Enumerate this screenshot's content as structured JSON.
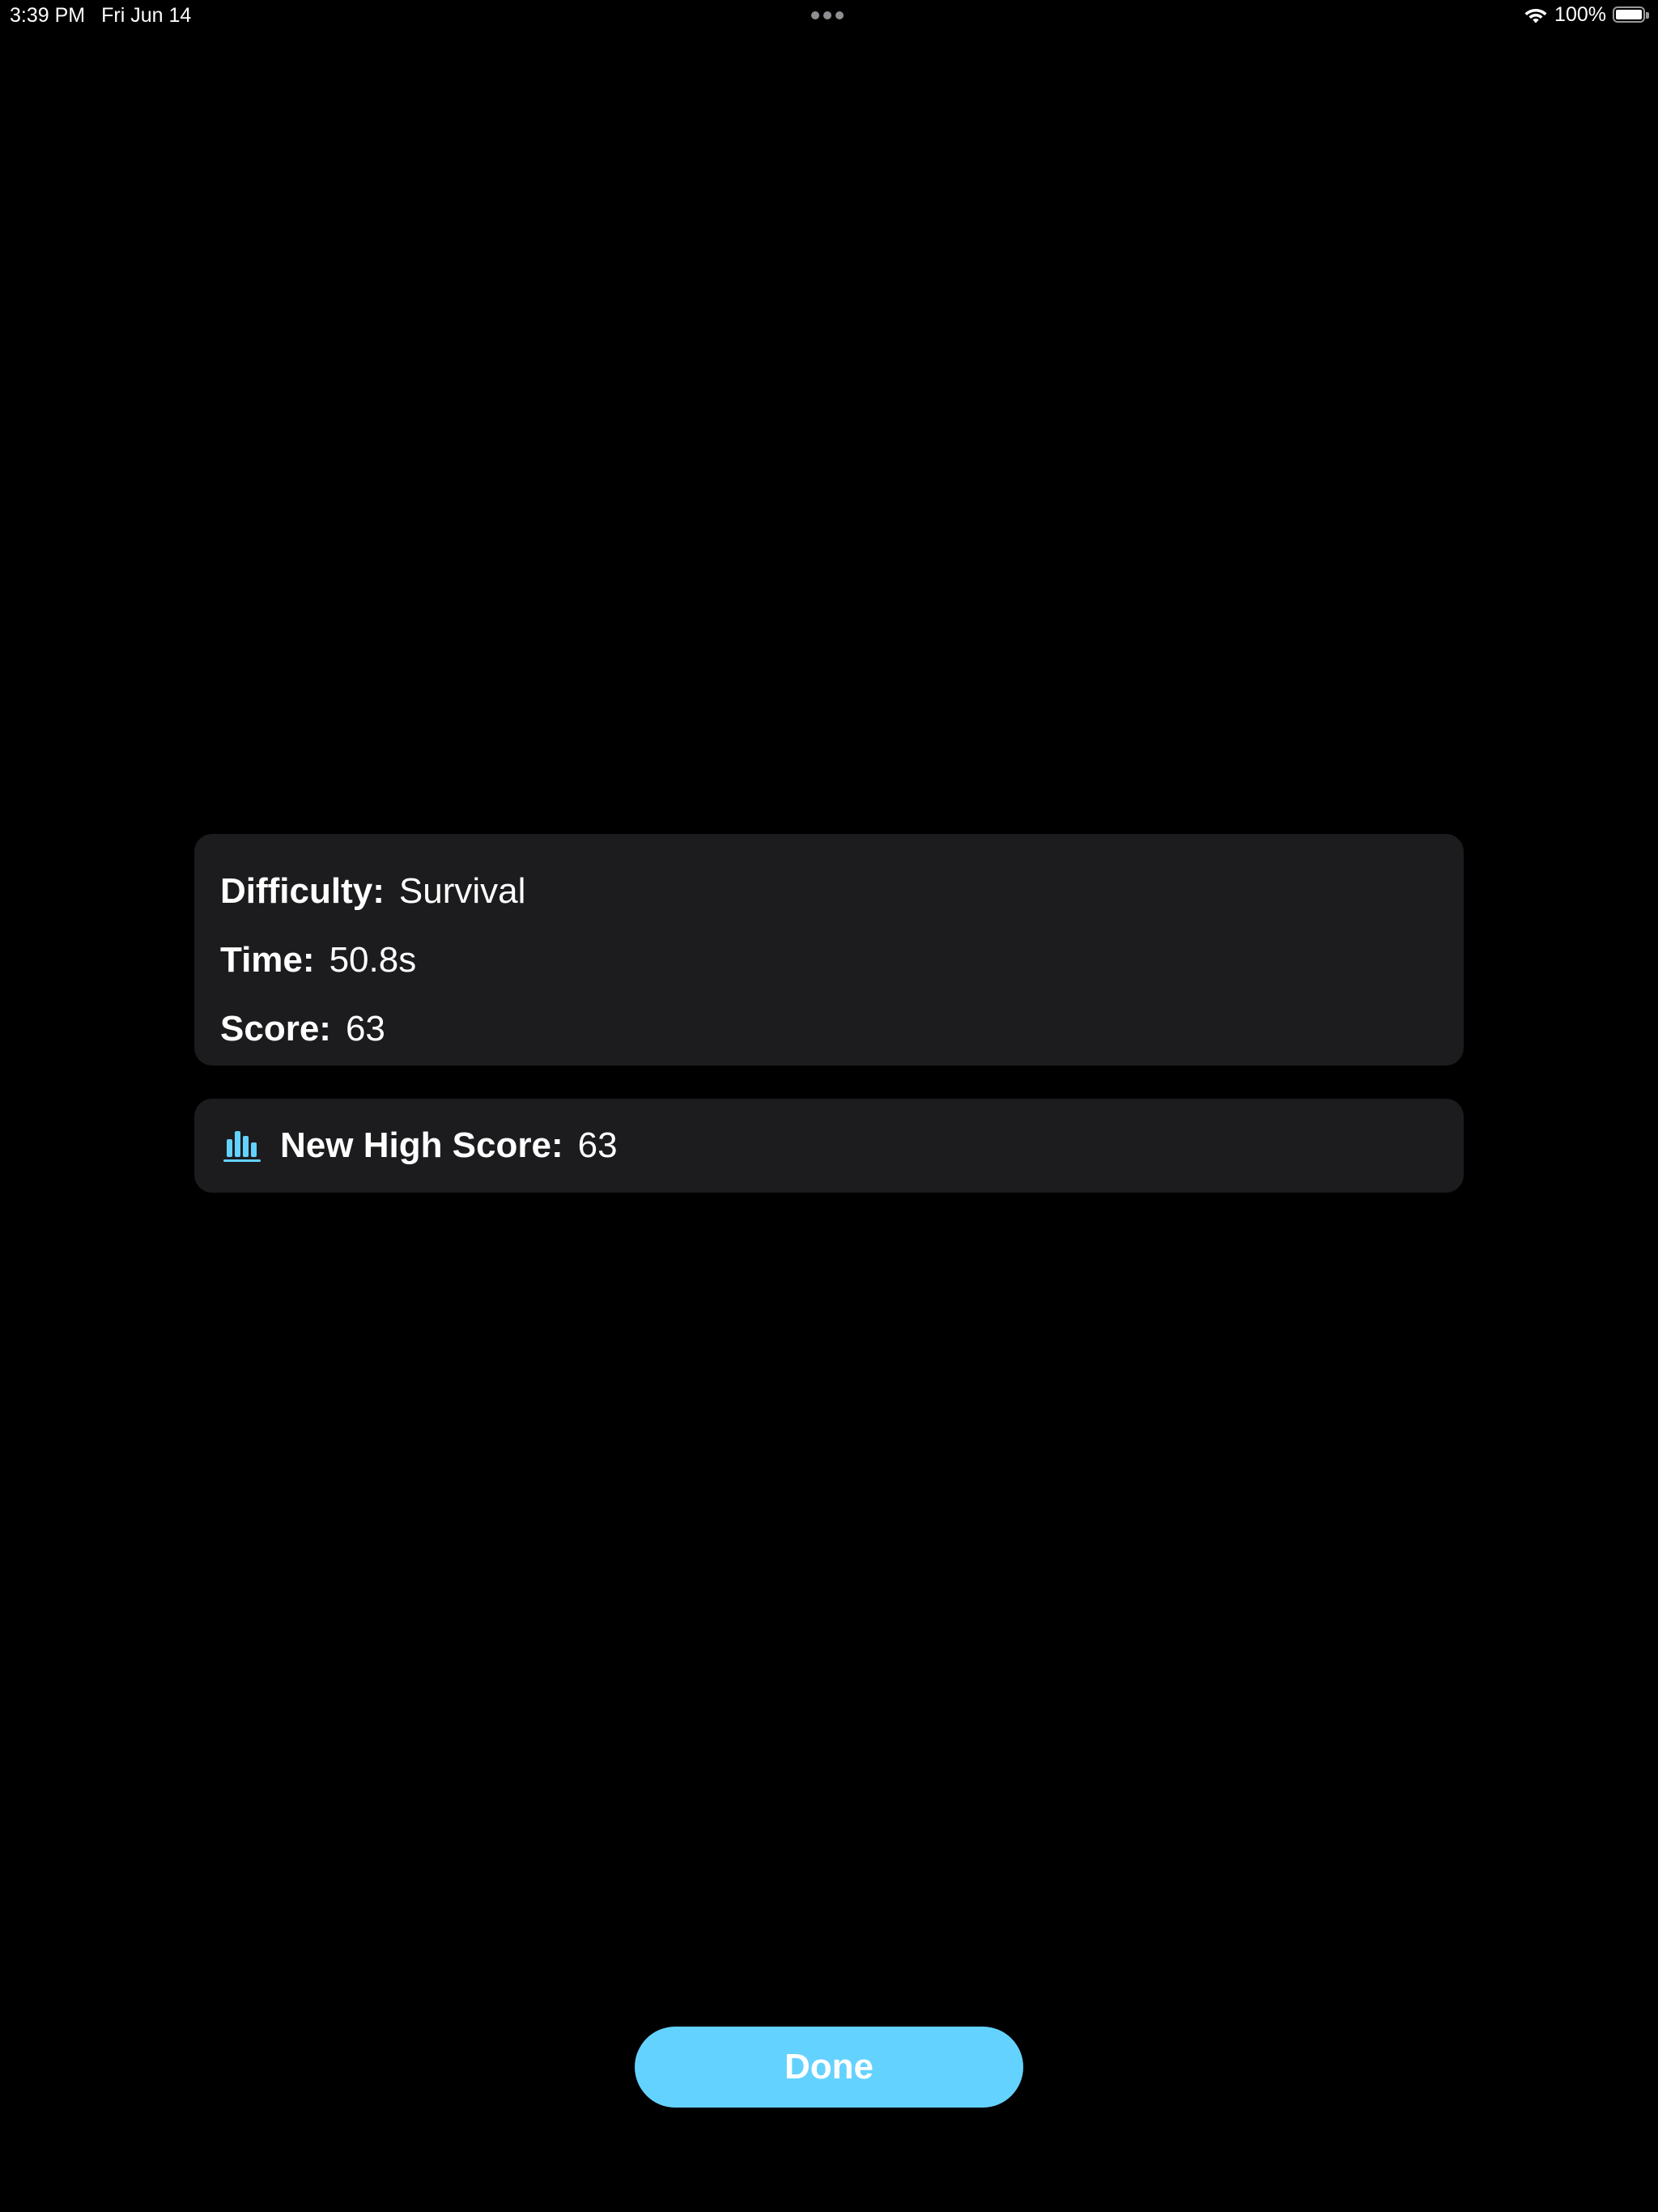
{
  "status_bar": {
    "time": "3:39 PM",
    "date": "Fri Jun 14",
    "battery_text": "100%",
    "battery_level": 1.0,
    "icons": [
      "multitasking-dots-icon",
      "wifi-icon",
      "battery-icon"
    ]
  },
  "summary": {
    "difficulty": {
      "label": "Difficulty:",
      "value": "Survival"
    },
    "time": {
      "label": "Time:",
      "value": "50.8s"
    },
    "score": {
      "label": "Score:",
      "value": "63"
    }
  },
  "high_score": {
    "icon": "chart-bar-icon",
    "label": "New High Score:",
    "value": "63"
  },
  "done_button": {
    "label": "Done"
  },
  "colors": {
    "background": "#000000",
    "card": "#1c1c1e",
    "accent": "#64d2ff",
    "text": "#ffffff"
  }
}
